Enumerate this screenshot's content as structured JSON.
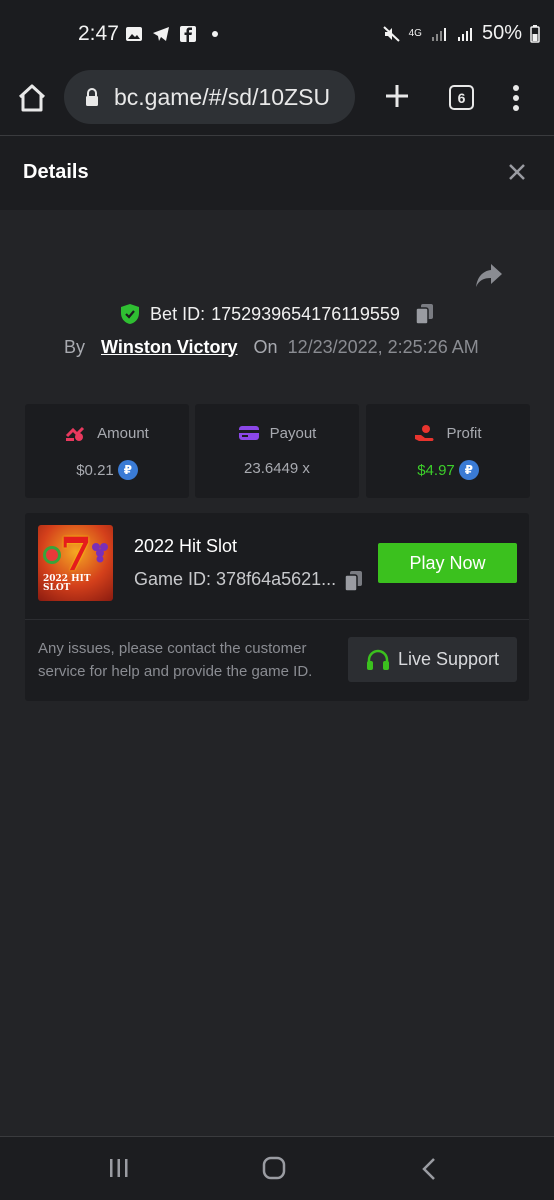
{
  "status_bar": {
    "time": "2:47",
    "battery": "50%",
    "network_label": "4G",
    "icons": [
      "image-icon",
      "telegram-icon",
      "facebook-icon",
      "dot-icon",
      "mute-icon",
      "network-icon",
      "signal-icon",
      "signal-icon",
      "battery-icon"
    ]
  },
  "browser": {
    "url": "bc.game/#/sd/10ZSU",
    "tab_count": "6"
  },
  "details": {
    "title": "Details",
    "bet_id_label": "Bet ID:",
    "bet_id": "1752939654176119559",
    "by_label": "By",
    "user": "Winston Victory",
    "on_label": "On",
    "date": "12/23/2022, 2:25:26 AM"
  },
  "stats": [
    {
      "label": "Amount",
      "value": "$0.21",
      "icon": "amount-icon",
      "coin": "₽"
    },
    {
      "label": "Payout",
      "value": "23.6449 x",
      "icon": "card-icon"
    },
    {
      "label": "Profit",
      "value": "$4.97",
      "icon": "profit-icon",
      "coin": "₽"
    }
  ],
  "game": {
    "title": "2022 Hit Slot",
    "game_id_label": "Game ID:",
    "game_id": "378f64a5621...",
    "thumb_text_line1": "2022 HIT",
    "thumb_text_line2": "SLOT",
    "thumb_glyph": "7",
    "play_label": "Play Now",
    "issue_text": "Any issues, please contact the customer service for help and provide the game ID.",
    "support_label": "Live Support"
  },
  "colors": {
    "accent_green": "#3bc11e",
    "profit_green": "#3ccf2a",
    "background": "#232427",
    "card": "#1b1c1f"
  }
}
